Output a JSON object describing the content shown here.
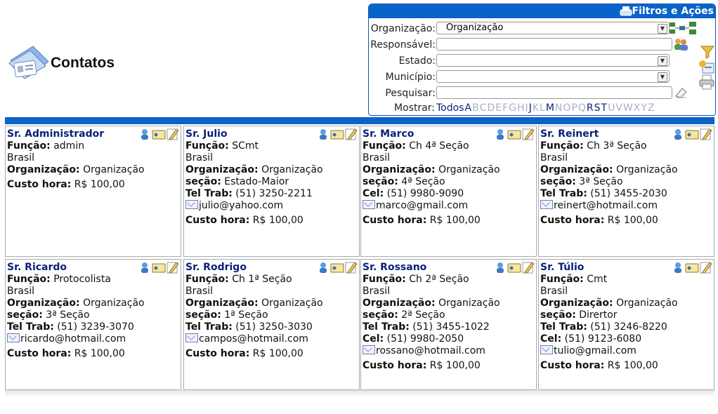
{
  "page": {
    "title": "Contatos"
  },
  "filters": {
    "header": "Filtros e Ações",
    "organizacao_label": "Organização:",
    "organizacao_value": "Organização",
    "responsavel_label": "Responsável:",
    "responsavel_value": "",
    "estado_label": "Estado:",
    "estado_value": "",
    "municipio_label": "Município:",
    "municipio_value": "",
    "pesquisar_label": "Pesquisar:",
    "pesquisar_value": "",
    "mostrar_label": "Mostrar:",
    "letters": [
      {
        "t": "Todos",
        "active": true
      },
      {
        "t": "A",
        "active": true
      },
      {
        "t": "B",
        "active": false
      },
      {
        "t": "C",
        "active": false
      },
      {
        "t": "D",
        "active": false
      },
      {
        "t": "E",
        "active": false
      },
      {
        "t": "F",
        "active": false
      },
      {
        "t": "G",
        "active": false
      },
      {
        "t": "H",
        "active": false
      },
      {
        "t": "I",
        "active": false
      },
      {
        "t": "J",
        "active": true
      },
      {
        "t": "K",
        "active": false
      },
      {
        "t": "L",
        "active": false
      },
      {
        "t": "M",
        "active": true
      },
      {
        "t": "N",
        "active": false
      },
      {
        "t": "O",
        "active": false
      },
      {
        "t": "P",
        "active": false
      },
      {
        "t": "Q",
        "active": false
      },
      {
        "t": "R",
        "active": true
      },
      {
        "t": "S",
        "active": true
      },
      {
        "t": "T",
        "active": true
      },
      {
        "t": "U",
        "active": false
      },
      {
        "t": "V",
        "active": false
      },
      {
        "t": "W",
        "active": false
      },
      {
        "t": "X",
        "active": false
      },
      {
        "t": "Y",
        "active": false
      },
      {
        "t": "Z",
        "active": false
      }
    ]
  },
  "labels": {
    "funcao": "Função:",
    "organizacao": "Organização:",
    "secao": "seção:",
    "tel_trab": "Tel Trab:",
    "cel": "Cel:",
    "custo_hora": "Custo hora:"
  },
  "contacts": [
    {
      "name": "Sr. Administrador",
      "funcao": "admin",
      "pais": "Brasil",
      "organizacao": "Organização",
      "custo": "R$ 100,00"
    },
    {
      "name": "Sr. Julio",
      "funcao": "SCmt",
      "pais": "Brasil",
      "organizacao": "Organização",
      "secao": "Estado-Maior",
      "tel": "(51) 3250-2211",
      "email": "julio@yahoo.com",
      "custo": "R$ 100,00"
    },
    {
      "name": "Sr. Marco",
      "funcao": "Ch 4ª Seção",
      "pais": "Brasil",
      "organizacao": "Organização",
      "secao": "4ª Seção",
      "cel": "(51) 9980-9090",
      "email": "marco@gmail.com",
      "custo": "R$ 100,00"
    },
    {
      "name": "Sr. Reinert",
      "funcao": "Ch 3ª Seção",
      "pais": "Brasil",
      "organizacao": "Organização",
      "secao": "3ª Seção",
      "tel": "(51) 3455-2030",
      "email": "reinert@hotmail.com",
      "custo": "R$ 100,00"
    },
    {
      "name": "Sr. Ricardo",
      "funcao": "Protocolista",
      "pais": "Brasil",
      "organizacao": "Organização",
      "secao": "3ª Seção",
      "tel": "(51) 3239-3070",
      "email": "ricardo@hotmail.com",
      "custo": "R$ 100,00"
    },
    {
      "name": "Sr. Rodrigo",
      "funcao": "Ch 1ª Seção",
      "pais": "Brasil",
      "organizacao": "Organização",
      "secao": "1ª Seção",
      "tel": "(51) 3250-3030",
      "email": "campos@hotmail.com",
      "custo": "R$ 100,00"
    },
    {
      "name": "Sr. Rossano",
      "funcao": "Ch 2ª Seção",
      "pais": "Brasil",
      "organizacao": "Organização",
      "secao": "2ª Seção",
      "tel": "(51) 3455-1022",
      "cel": "(51) 9980-2050",
      "email": "rossano@hotmail.com",
      "custo": "R$ 100,00"
    },
    {
      "name": "Sr. Túlio",
      "funcao": "Cmt",
      "pais": "Brasil",
      "organizacao": "Organização",
      "secao": "Dirertor",
      "tel": "(51) 3246-8220",
      "cel": "(51) 9123-6080",
      "email": "tulio@gmail.com",
      "custo": "R$ 100,00"
    }
  ],
  "icons": [
    "contacts-logo-icon",
    "printer-icon",
    "org-chart-icon",
    "users-icon",
    "eraser-icon",
    "filter-icon",
    "new-contact-icon",
    "print-icon",
    "user-icon",
    "vcard-icon",
    "edit-icon",
    "envelope-icon"
  ],
  "colors": {
    "accent": "#0a63c9",
    "name": "#0a1f7a",
    "inactive_letter": "#aab0c4"
  }
}
